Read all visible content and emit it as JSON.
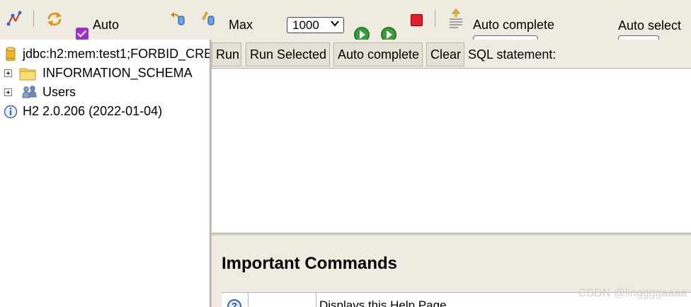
{
  "toolbar": {
    "auto_commit_label": "Auto",
    "auto_commit_checked": true,
    "max_label": "Max",
    "max_rows_value": "1000",
    "auto_complete_label": "Auto complete",
    "auto_select_label": "Auto select",
    "icons": [
      "disconnect-icon",
      "refresh-icon",
      "rollback-icon",
      "commit-icon",
      "run-icon",
      "run-selected-icon",
      "stop-icon",
      "history-icon"
    ]
  },
  "tree": {
    "connection": "jdbc:h2:mem:test1;FORBID_CRE",
    "schema": "INFORMATION_SCHEMA",
    "users": "Users",
    "version": "H2 2.0.206 (2022-01-04)"
  },
  "query": {
    "run_label": "Run",
    "run_selected_label": "Run Selected",
    "auto_complete_label": "Auto complete",
    "clear_label": "Clear",
    "sql_statement_label": "SQL statement:"
  },
  "help": {
    "title": "Important Commands",
    "first_row_description": "Displays this Help Page",
    "first_row_icon": "?"
  },
  "watermark": "CSDN @linggggaaaa"
}
